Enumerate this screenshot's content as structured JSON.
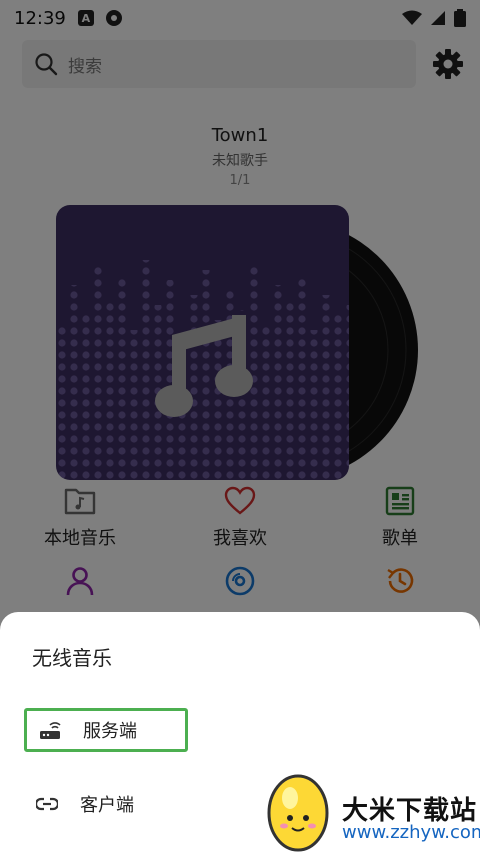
{
  "status_bar": {
    "time": "12:39",
    "badge_letter": "A"
  },
  "search": {
    "placeholder": "搜索"
  },
  "now_playing": {
    "title": "Town1",
    "artist": "未知歌手",
    "position": "1/1"
  },
  "quick_access": [
    {
      "label": "本地音乐",
      "icon": "folder-music-icon",
      "color": "#6a6a6a"
    },
    {
      "label": "我喜欢",
      "icon": "heart-icon",
      "color": "#d32f2f"
    },
    {
      "label": "歌单",
      "icon": "playlist-icon",
      "color": "#2e7d32"
    },
    {
      "label": "",
      "icon": "person-icon",
      "color": "#8e24aa"
    },
    {
      "label": "",
      "icon": "disc-icon",
      "color": "#1976d2"
    },
    {
      "label": "",
      "icon": "history-icon",
      "color": "#ef6c00"
    }
  ],
  "sheet": {
    "title": "无线音乐",
    "options": [
      {
        "label": "服务端",
        "icon": "router-icon",
        "selected": true
      },
      {
        "label": "客户端",
        "icon": "link-icon",
        "selected": false
      }
    ]
  },
  "watermark": {
    "brand": "大米下载站",
    "url": "www.zzhyw.com"
  },
  "colors": {
    "album_bg": "#3d2f62",
    "sheet_highlight": "#4caf50",
    "overlay": "rgba(0,0,0,0.5)"
  }
}
